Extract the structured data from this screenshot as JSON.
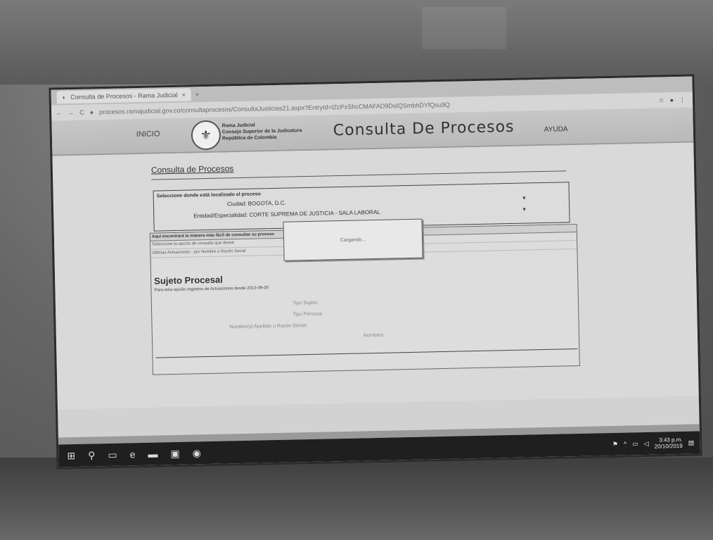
{
  "browser": {
    "tab_title": "Consulta de Procesos - Rama Judicial",
    "url": "procesos.ramajudicial.gov.co/consultaprocesos/ConsultaJusticias21.aspx?EntryId=lZcPxShcCMAFAD9DsIQSmbhDYfQsu9Q",
    "new_tab": "+"
  },
  "header": {
    "inicio": "INICIO",
    "entity_lines": [
      "Rama Judicial",
      "Consejo Superior de la Judicatura",
      "República de Colombia"
    ],
    "title": "Consulta De Procesos",
    "ayuda": "AYUDA"
  },
  "page": {
    "title": "Consulta de Procesos",
    "select_label": "Seleccione donde está localizado el proceso",
    "ciudad_label": "Ciudad:",
    "ciudad_value": "BOGOTA, D.C.",
    "entidad_label": "Entidad/Especialidad:",
    "entidad_value": "CORTE SUPREMA DE JUSTICIA - SALA LABORAL",
    "popup_text": "Cargando...",
    "options_bar": "Aquí encontrará la manera más fácil de consultar su proceso",
    "option_line1": "Seleccione la opción de consulta que desee",
    "option_line2": "Ultimas Actuaciones - por Nombre o Razón Social",
    "sujeto_title": "Sujeto Procesal",
    "sujeto_sub": "Para esta opción registros de Actuaciones desde 2013-09-30",
    "form_lines": [
      "Tipo Sujeto:",
      "Tipo Persona:",
      "Nombre(s) Apellido o Razón Social:",
      "Nombres:"
    ]
  },
  "taskbar": {
    "time": "3:43 p.m.",
    "date": "20/10/2019"
  }
}
